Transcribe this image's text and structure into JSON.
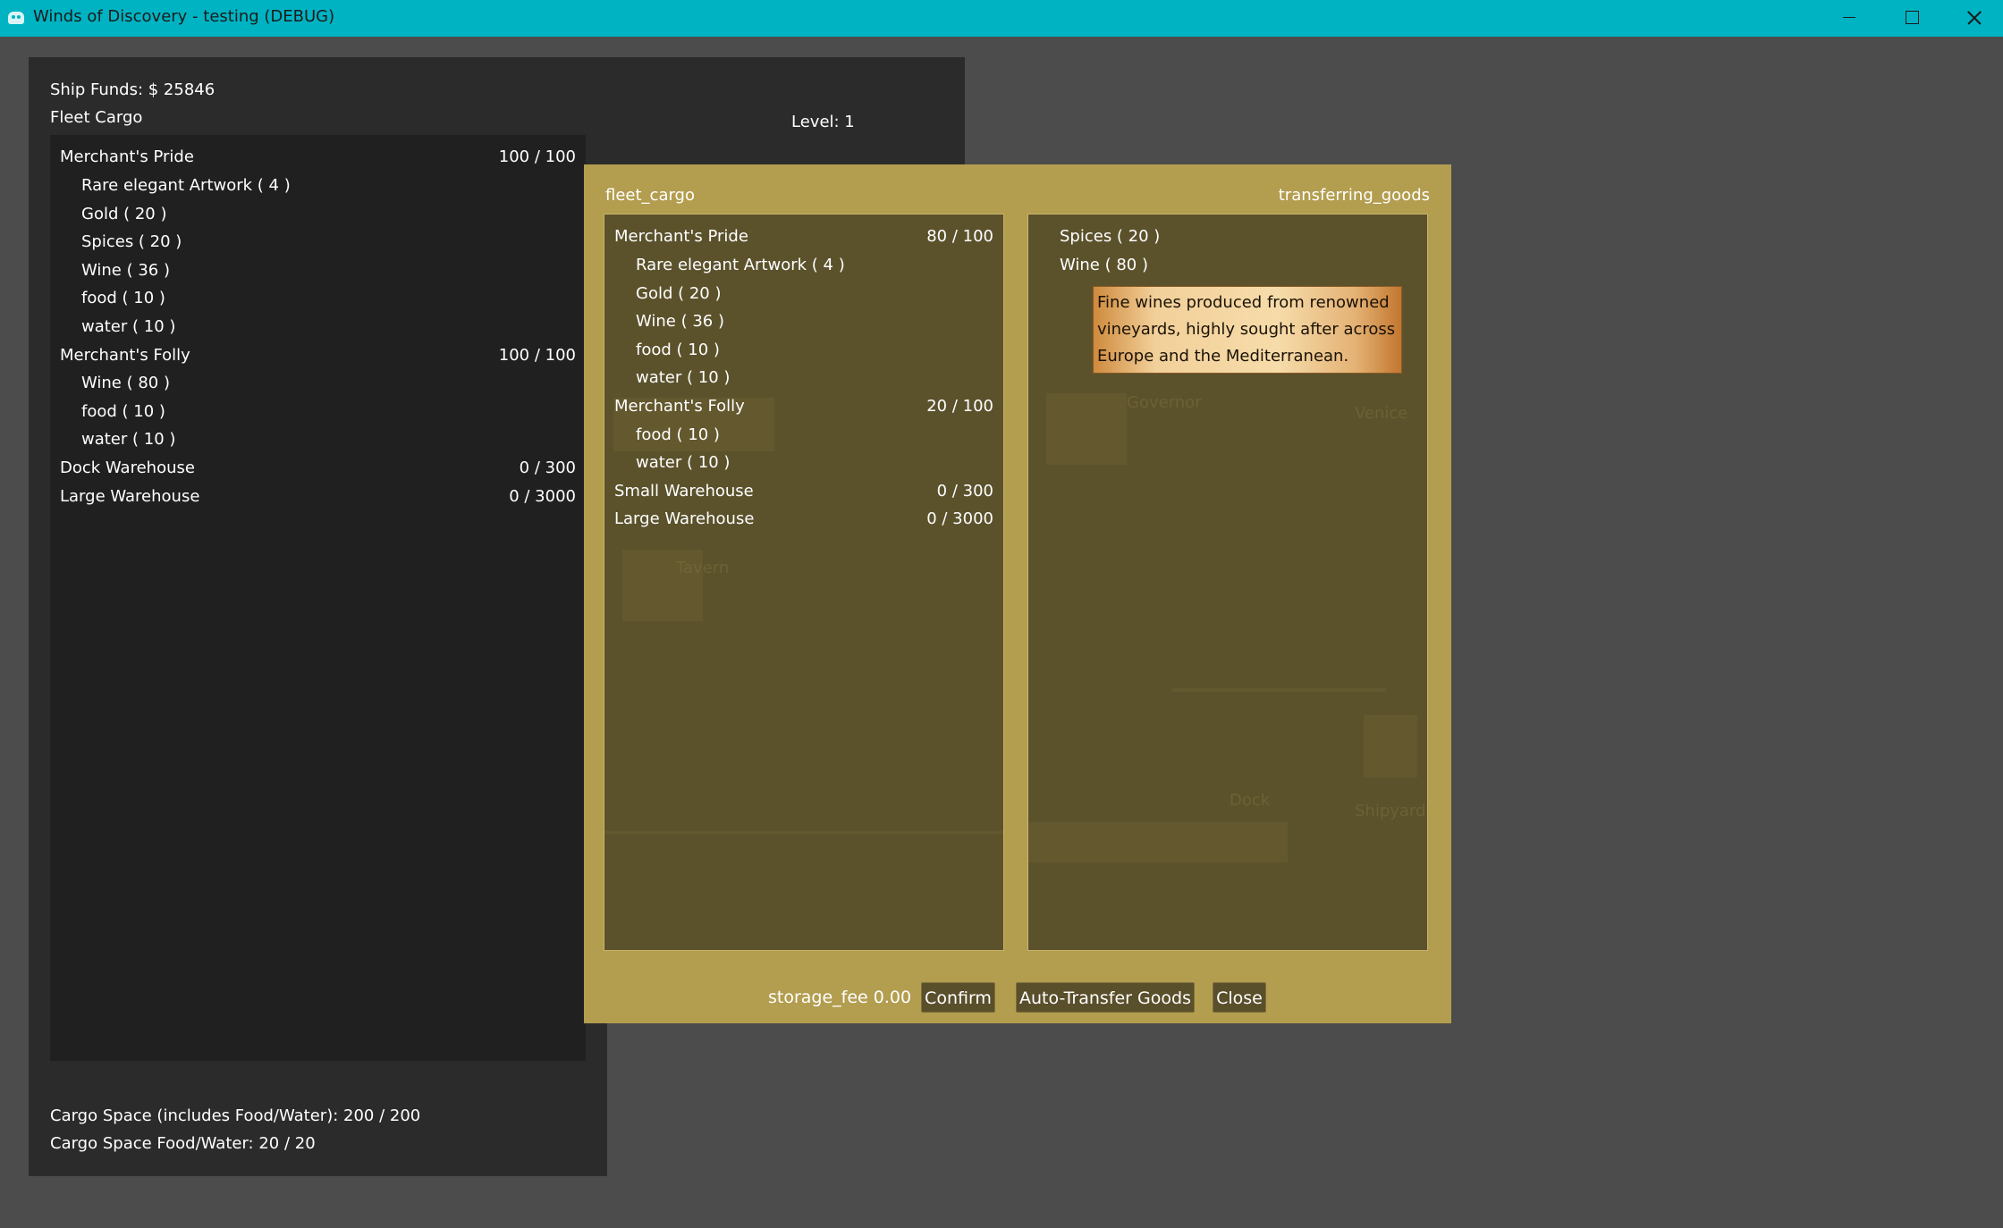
{
  "window": {
    "title": "Winds of Discovery - testing  (DEBUG)",
    "icon": "godot-icon"
  },
  "fleet_panel": {
    "funds_label": "Ship Funds: $  25846",
    "cargo_title": "Fleet  Cargo",
    "level_label": "Level:  1",
    "rows": [
      {
        "name": "Merchant's Pride",
        "cap": "100 / 100"
      },
      {
        "name": "Rare elegant Artwork ( 4 )"
      },
      {
        "name": "Gold ( 20 )"
      },
      {
        "name": "Spices ( 20 )"
      },
      {
        "name": "Wine ( 36 )"
      },
      {
        "name": "food ( 10 )"
      },
      {
        "name": "water ( 10 )"
      },
      {
        "name": "Merchant's Folly",
        "cap": "100 / 100"
      },
      {
        "name": "Wine ( 80 )"
      },
      {
        "name": "food ( 10 )"
      },
      {
        "name": "water ( 10 )"
      },
      {
        "name": "Dock Warehouse",
        "cap": "0 / 300"
      },
      {
        "name": "Large Warehouse",
        "cap": "0 / 3000"
      }
    ],
    "cargo_space": "Cargo Space (includes Food/Water):  200 / 200",
    "food_water_space": "Cargo Space Food/Water:  20 / 20"
  },
  "transfer_dialog": {
    "left_title": "fleet_cargo",
    "right_title": "transferring_goods",
    "left_rows": [
      {
        "name": "Merchant's Pride",
        "cap": "80 / 100"
      },
      {
        "name": "Rare elegant Artwork ( 4 )"
      },
      {
        "name": "Gold ( 20 )"
      },
      {
        "name": "Wine ( 36 )"
      },
      {
        "name": "food ( 10 )"
      },
      {
        "name": "water ( 10 )"
      },
      {
        "name": "Merchant's Folly",
        "cap": "20 / 100"
      },
      {
        "name": "food ( 10 )"
      },
      {
        "name": "water ( 10 )"
      },
      {
        "name": "Small Warehouse",
        "cap": "0 / 300"
      },
      {
        "name": "Large Warehouse",
        "cap": "0 / 3000"
      }
    ],
    "right_rows": [
      {
        "name": "Spices ( 20 )"
      },
      {
        "name": "Wine ( 80 )"
      }
    ],
    "tooltip": "Fine wines produced from renowned vineyards, highly sought after across Europe and the Mediterranean.",
    "background_labels": [
      "Governor",
      "Venice",
      "Tavern",
      "Dock",
      "Shipyard"
    ],
    "storage_fee": "storage_fee 0.00",
    "buttons": {
      "confirm": "Confirm",
      "auto": "Auto-Transfer Goods",
      "close": "Close"
    }
  }
}
